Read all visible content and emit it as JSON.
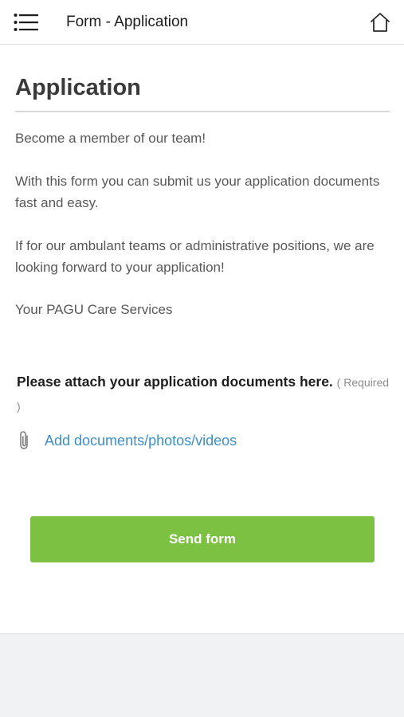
{
  "header": {
    "title": "Form  -  Application",
    "menu_icon": "hamburger-list-icon",
    "home_icon": "home-icon"
  },
  "main": {
    "title": "Application",
    "paragraphs": [
      "Become a member of our team!",
      "With this form you can submit us your application documents fast and easy.",
      "If for our ambulant teams or administrative positions, we are looking forward to your application!",
      "Your PAGU Care Services"
    ],
    "attachment": {
      "label": "Please attach your application documents here.",
      "required_text": "( Required )",
      "link_text": "Add documents/photos/videos",
      "icon": "paperclip-icon"
    },
    "submit_label": "Send form"
  },
  "colors": {
    "accent_green": "#7cc142",
    "link_blue": "#3b8ec8"
  }
}
